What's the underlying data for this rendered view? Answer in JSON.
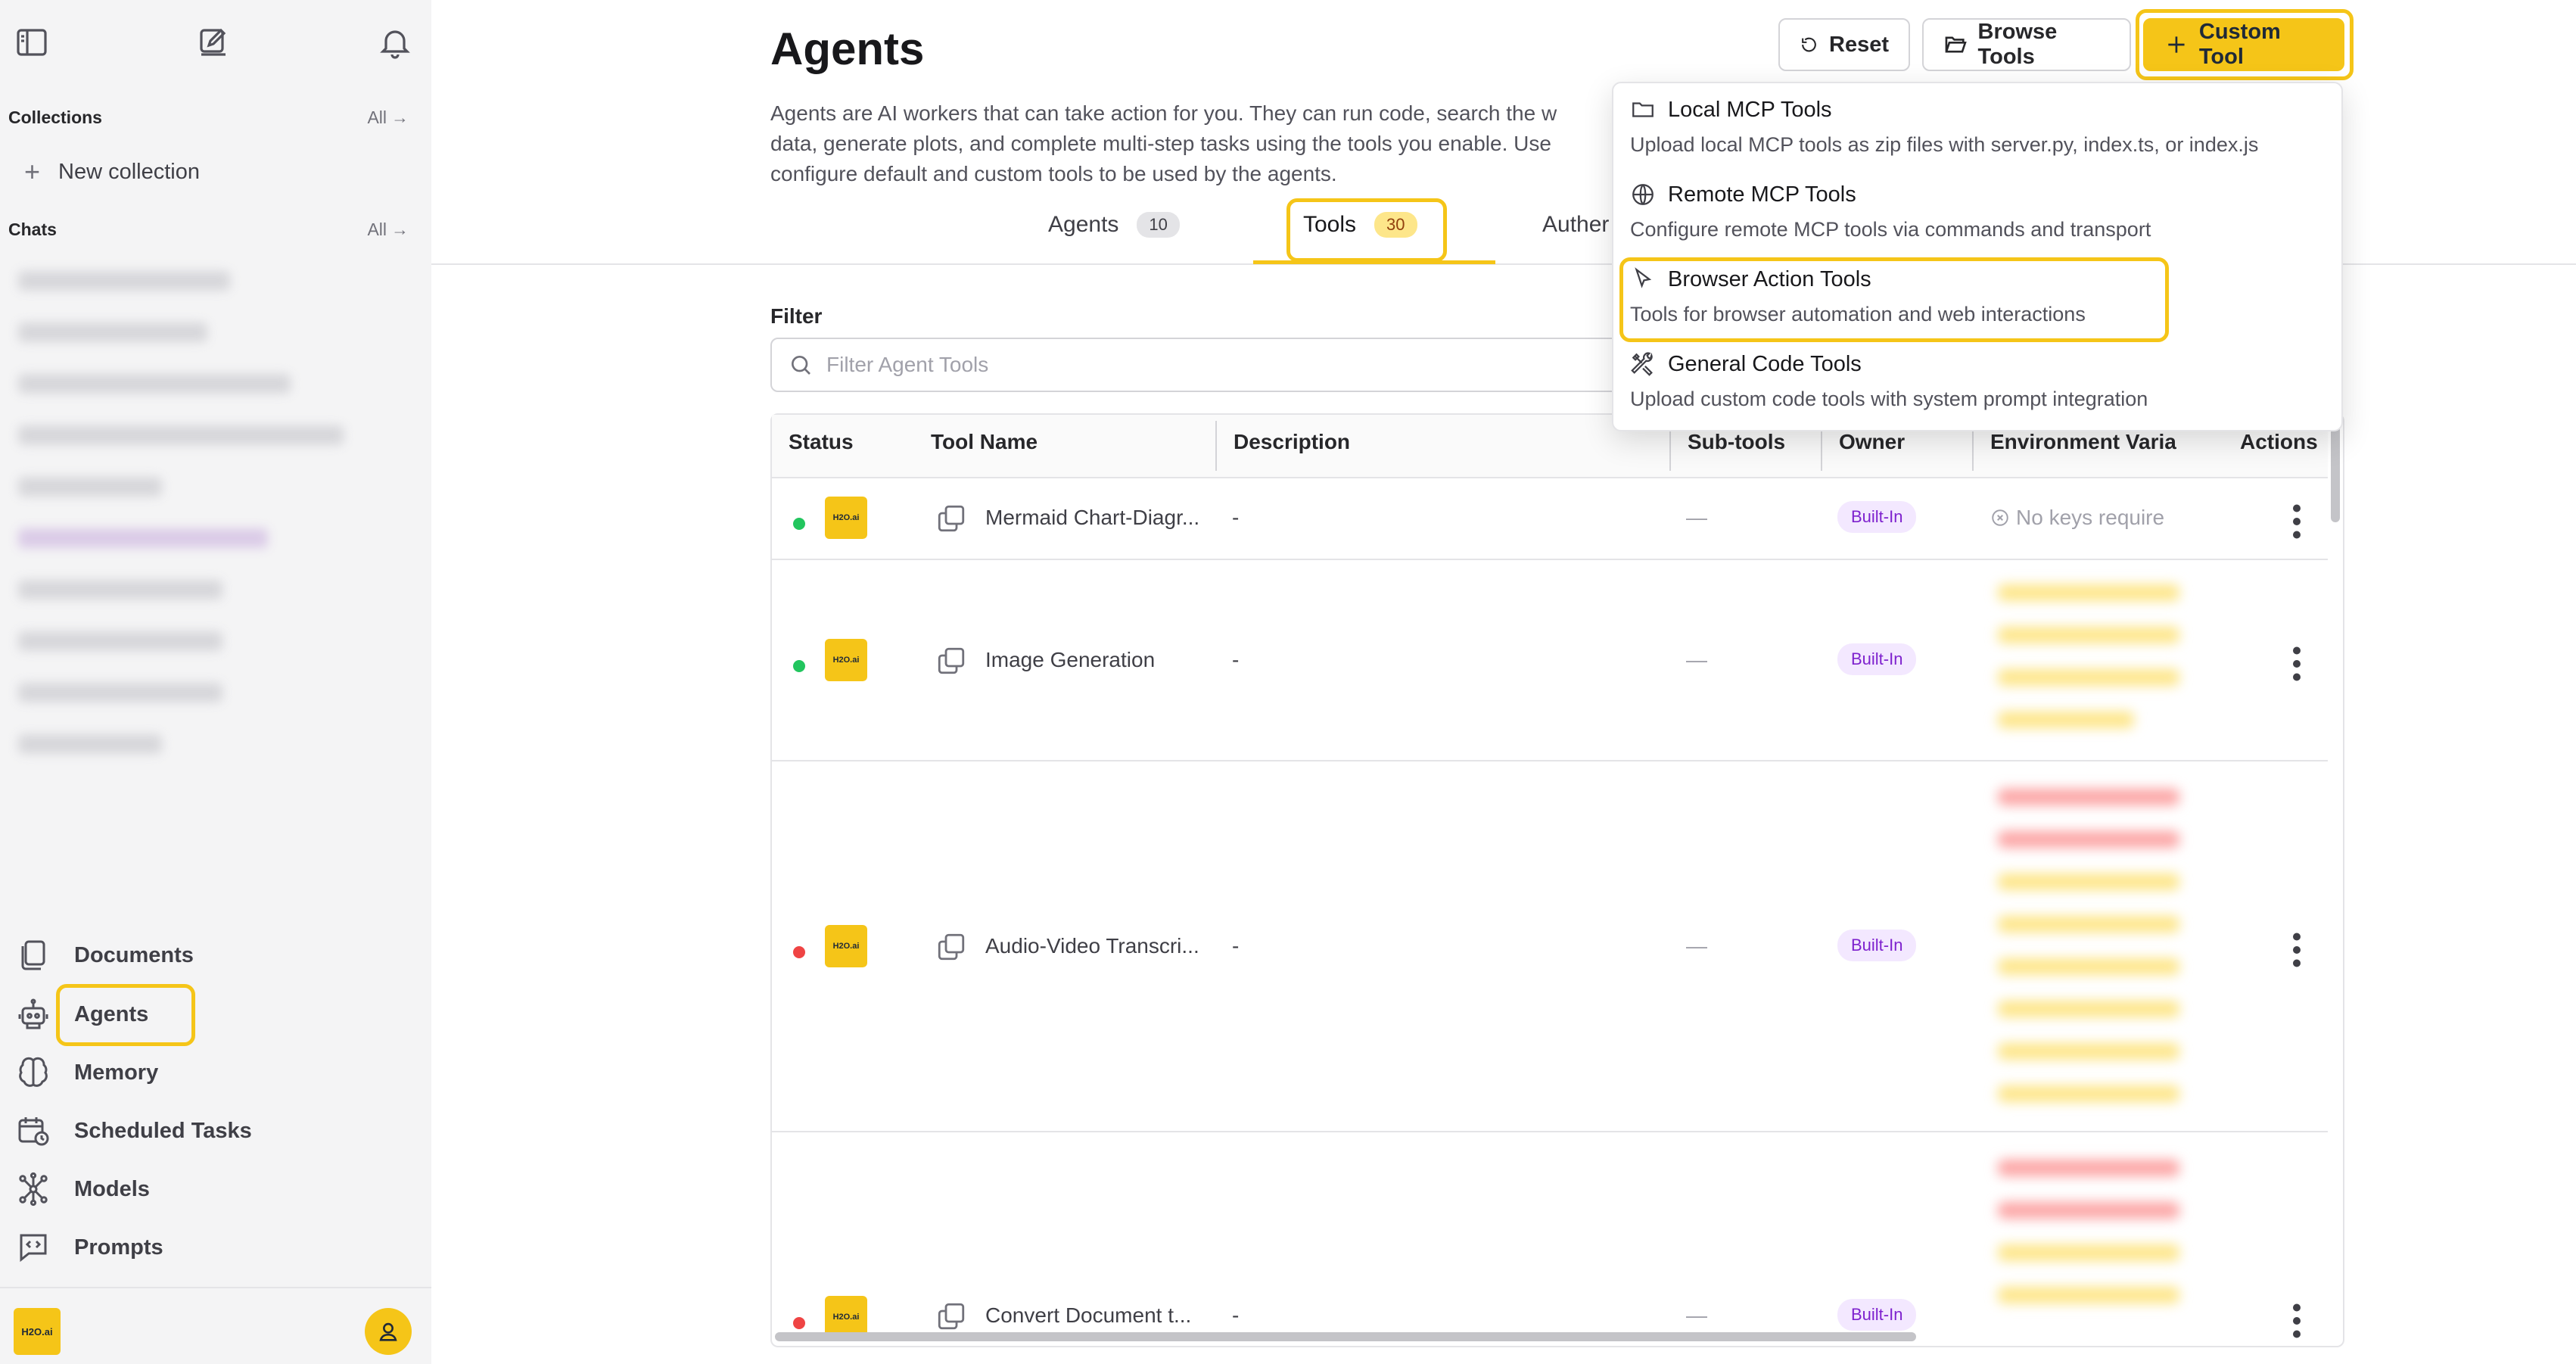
{
  "sidebar": {
    "collections_label": "Collections",
    "collections_all": "All",
    "new_collection": "New collection",
    "chats_label": "Chats",
    "chats_all": "All",
    "nav": [
      {
        "label": "Documents",
        "icon": "documents-icon"
      },
      {
        "label": "Agents",
        "icon": "robot-icon"
      },
      {
        "label": "Memory",
        "icon": "brain-icon"
      },
      {
        "label": "Scheduled Tasks",
        "icon": "calendar-clock-icon"
      },
      {
        "label": "Models",
        "icon": "models-icon"
      },
      {
        "label": "Prompts",
        "icon": "prompt-icon"
      }
    ],
    "brand_logo_text": "H2O.ai"
  },
  "header": {
    "title": "Agents",
    "description_line1": "Agents are AI workers that can take action for you. They can run code, search the w",
    "description_line2": "data, generate plots, and complete multi-step tasks using the tools you enable. Use",
    "description_line3": "configure default and custom tools to be used by the agents.",
    "reset_label": "Reset",
    "browse_tools_label": "Browse Tools",
    "custom_tool_label": "Custom Tool"
  },
  "tabs": [
    {
      "label": "Agents",
      "count": "10"
    },
    {
      "label": "Tools",
      "count": "30"
    },
    {
      "label": "Auther",
      "count": ""
    }
  ],
  "filter": {
    "label": "Filter",
    "placeholder": "Filter Agent Tools"
  },
  "table": {
    "headers": [
      "Status",
      "Tool Name",
      "Description",
      "Sub-tools",
      "Owner",
      "Environment Varia",
      "Actions"
    ],
    "rows": [
      {
        "status": "green",
        "name": "Mermaid Chart-Diagr...",
        "description": "-",
        "subtools": "—",
        "owner": "Built-In",
        "env": "No keys require"
      },
      {
        "status": "green",
        "name": "Image Generation",
        "description": "-",
        "subtools": "—",
        "owner": "Built-In",
        "env": ""
      },
      {
        "status": "red",
        "name": "Audio-Video Transcri...",
        "description": "-",
        "subtools": "—",
        "owner": "Built-In",
        "env": ""
      },
      {
        "status": "red",
        "name": "Convert Document t...",
        "description": "-",
        "subtools": "—",
        "owner": "Built-In",
        "env": ""
      }
    ]
  },
  "dropdown": {
    "items": [
      {
        "title": "Local MCP Tools",
        "desc": "Upload local MCP tools as zip files with server.py, index.ts, or index.js",
        "icon": "folder-icon"
      },
      {
        "title": "Remote MCP Tools",
        "desc": "Configure remote MCP tools via commands and transport",
        "icon": "globe-icon"
      },
      {
        "title": "Browser Action Tools",
        "desc": "Tools for browser automation and web interactions",
        "icon": "cursor-icon"
      },
      {
        "title": "General Code Tools",
        "desc": "Upload custom code tools with system prompt integration",
        "icon": "tools-icon"
      }
    ]
  },
  "colors": {
    "accent": "#f5c518",
    "status_green": "#22c55e",
    "status_red": "#ef4444",
    "owner_pill": "#7e22ce"
  }
}
